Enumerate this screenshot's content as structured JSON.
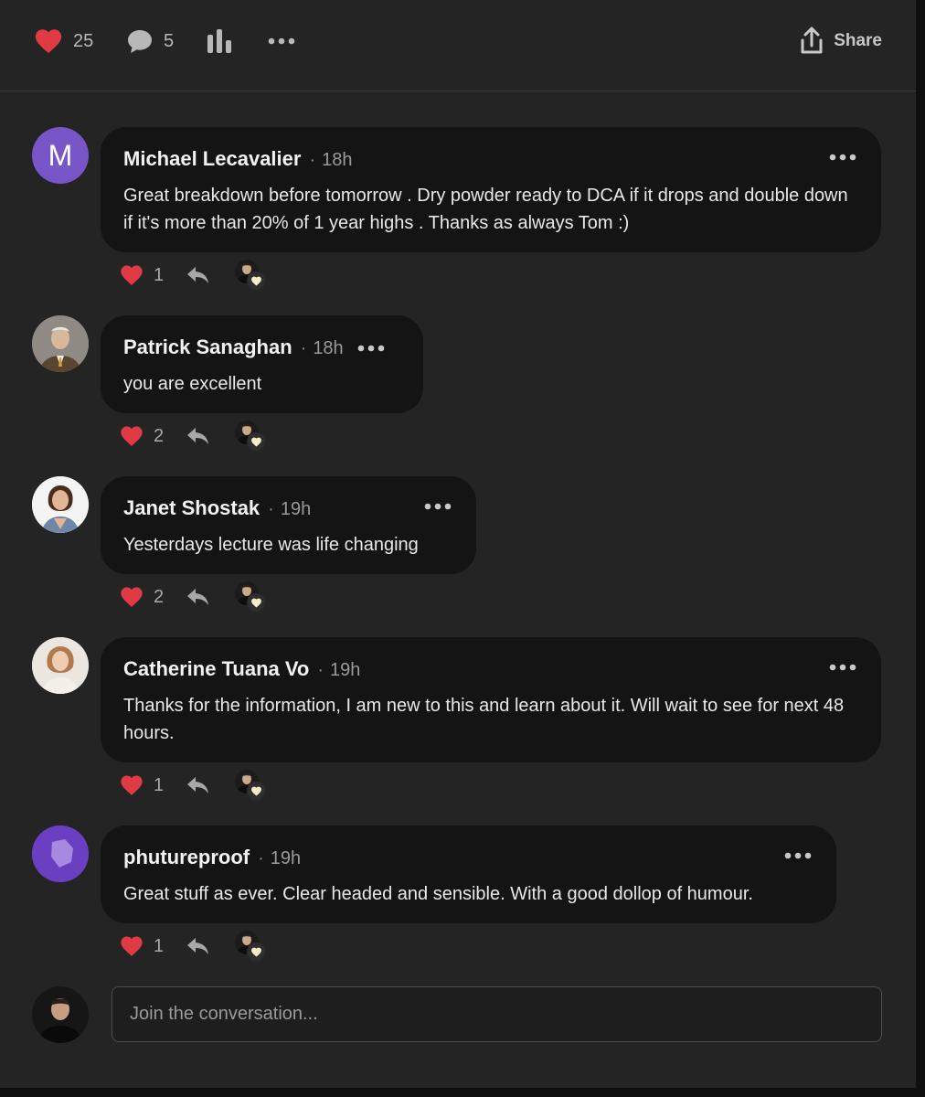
{
  "topbar": {
    "like_count": "25",
    "comment_count": "5",
    "share_label": "Share",
    "icons": {
      "like": "heart-icon",
      "comment": "comment-bubble-icon",
      "stats": "bar-chart-icon",
      "more": "more-dots-icon",
      "share": "share-upload-icon"
    }
  },
  "colors": {
    "heart": "#e03a45",
    "panel": "#242424",
    "bubble": "#141414"
  },
  "comments": [
    {
      "author": "Michael Lecavalier",
      "time": "18h",
      "text": "Great breakdown before tomorrow . Dry powder ready to DCA if it drops and double down if it's more than 20% of 1 year highs . Thanks as always Tom :)",
      "likes": "1",
      "avatar_letter": "M"
    },
    {
      "author": "Patrick Sanaghan",
      "time": "18h",
      "text": "you are excellent",
      "likes": "2"
    },
    {
      "author": "Janet Shostak",
      "time": "19h",
      "text": "Yesterdays lecture was life changing",
      "likes": "2"
    },
    {
      "author": "Catherine Tuana Vo",
      "time": "19h",
      "text": "Thanks for the information, I am new to this and learn about it. Will wait to see for next 48 hours.",
      "likes": "1"
    },
    {
      "author": "phutureproof",
      "time": "19h",
      "text": "Great stuff as ever. Clear headed and sensible. With a good dollop of humour.",
      "likes": "1"
    }
  ],
  "composer": {
    "placeholder": "Join the conversation..."
  }
}
